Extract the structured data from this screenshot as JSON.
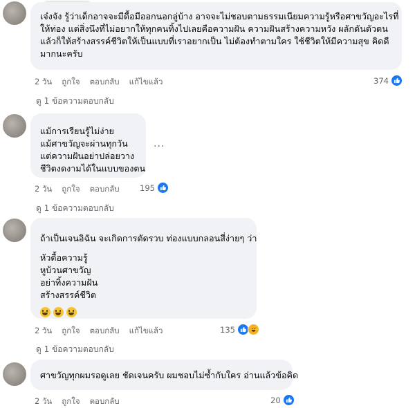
{
  "comments": [
    {
      "lines": [
        "เจ๋งจัง รู้ว่าเด็กอาจจะมีดื้อมีออกนอกลู่บ้าง อาจจะไม่ชอบตามธรรมเนียมความรู้หรือศาขวัญอะไรที่",
        "ให้ท่อง แต่สิ่งนึงที่ไม่อยากให้ทุกคนทิ้งไปเลยคือความฝัน ความฝันสร้างความหวัง ผลักดันตัวตน",
        "แล้วก็ให้สร้างสรรค์ชีวิตให้เป็นแบบที่เราอยากเป็น ไม่ต้องทำตามใคร ใช้ชีวิตให้มีความสุข คิดดี",
        "มากนะครับ"
      ],
      "time": "2 วัน",
      "like": "ถูกใจ",
      "reply": "ตอบกลับ",
      "edited": "แก้ไขแล้ว",
      "reactions": "374",
      "view_replies": "ดู 1 ข้อความตอบกลับ"
    },
    {
      "lines": [
        "แม้การเรียนรู้ไม่ง่าย",
        "แม้ศาขวัญจะผ่านทุกวัน",
        "แต่ความฝันอย่าปล่อยวาง",
        "ชีวิตงดงามได้ในแบบของตน"
      ],
      "time": "2 วัน",
      "like": "ถูกใจ",
      "reply": "ตอบกลับ",
      "reactions": "195",
      "more": "...",
      "view_replies": "ดู 1 ข้อความตอบกลับ"
    },
    {
      "intro": "ถ้าเป็นเจนอิฉัน จะเกิดการตัดรวบ ท่องแบบกลอนสี่ง่ายๆ ว่า",
      "lines": [
        "หัวดื้อความรู้",
        "หูบ้วนศาขวัญ",
        "อย่าทิ้งความฝัน",
        "สร้างสรรค์ชีวิต"
      ],
      "time": "2 วัน",
      "like": "ถูกใจ",
      "reply": "ตอบกลับ",
      "edited": "แก้ไขแล้ว",
      "reactions": "135",
      "view_replies": "ดู 1 ข้อความตอบกลับ"
    },
    {
      "lines": [
        "ศาขวัญทุกผมรอดูเลย ชัดเจนครับ ผมชอบไม่ซ้ำกับใคร อ่านแล้วข้อคิด"
      ],
      "time": "2 วัน",
      "like": "ถูกใจ",
      "reply": "ตอบกลับ",
      "reactions": "20"
    }
  ],
  "colors": {
    "bubble": "#f0f2f5",
    "meta": "#65676b",
    "like": "#1877f2"
  }
}
